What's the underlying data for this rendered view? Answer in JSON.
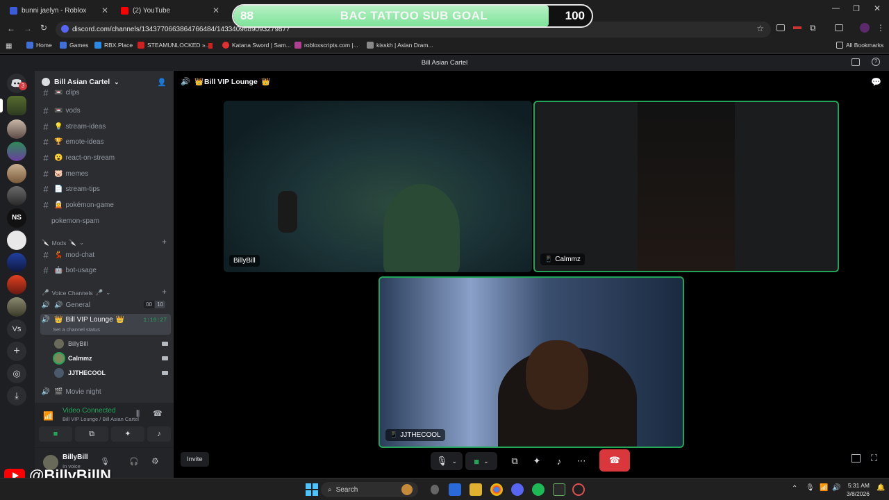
{
  "browser": {
    "tabs": [
      {
        "title": "bunni jaelyn - Roblox",
        "fav_color": "#3b5bdb"
      },
      {
        "title": "(2) YouTube",
        "fav_color": "#ff0000"
      }
    ],
    "url": "discord.com/channels/1343770663864766484/1433409689093279877",
    "bookmarks": [
      {
        "label": "Home",
        "color": "#3f6fd8"
      },
      {
        "label": "Games",
        "color": "#3f6fd8"
      },
      {
        "label": "RBX.Place",
        "color": "#2b8ae6"
      },
      {
        "label": "STEAMUNLOCKED »...",
        "color": "#d02020"
      },
      {
        "label": "Katana Sword | Sam...",
        "color": "#e03030"
      },
      {
        "label": "robloxscripts.com |...",
        "color": "#b04090"
      },
      {
        "label": "kisskh | Asian Dram...",
        "color": "#888888"
      }
    ],
    "all_bookmarks": "All Bookmarks"
  },
  "subgoal": {
    "current": "88",
    "title": "BAC TATTOO SUB GOAL",
    "target": "100",
    "progress": 0.88
  },
  "discord": {
    "window_title": "Bill Asian Cartel",
    "guild_name": "Bill Asian Cartel",
    "text_channels": [
      {
        "name": "clips",
        "emoji": "📼"
      },
      {
        "name": "vods",
        "emoji": "📼"
      },
      {
        "name": "stream-ideas",
        "emoji": "💡"
      },
      {
        "name": "emote-ideas",
        "emoji": "🏆"
      },
      {
        "name": "react-on-stream",
        "emoji": "😮"
      },
      {
        "name": "memes",
        "emoji": "🐷"
      },
      {
        "name": "stream-tips",
        "emoji": "📄"
      },
      {
        "name": "pokémon-game",
        "emoji": "🧝"
      },
      {
        "name": "pokemon-spam",
        "emoji": ""
      }
    ],
    "mods_category": "Mods",
    "mod_channels": [
      {
        "name": "mod-chat",
        "emoji": "💃"
      },
      {
        "name": "bot-usage",
        "emoji": "🤖"
      }
    ],
    "voice_category": "Voice Channels",
    "voice_channels": {
      "general": {
        "name": "General",
        "count_a": "00",
        "count_b": "10"
      },
      "vip": {
        "name": "Bill VIP Lounge",
        "timer": "1:10:27",
        "status": "Set a channel status"
      },
      "movie": {
        "name": "Movie night"
      }
    },
    "members": [
      "BillyBill",
      "Calmmz",
      "JJTHECOOL"
    ],
    "voice_panel": {
      "status": "Video Connected",
      "location": "Bill VIP Lounge / Bill Asian Cartel"
    },
    "user": {
      "name": "BillyBill",
      "state": "In voice"
    },
    "call_header": "Bill VIP Lounge",
    "tiles": [
      {
        "name": "BillyBill"
      },
      {
        "name": "Calmmz"
      },
      {
        "name": "JJTHECOOL"
      }
    ],
    "invite_label": "Invite",
    "rail_badge": "3",
    "rail_labels": {
      "ns": "NS",
      "vs": "Vs"
    }
  },
  "taskbar": {
    "search_label": "Search",
    "time": "5:31 AM",
    "date": "3/8/2026"
  },
  "overlay_handle": "@BillyBillN",
  "colors": {
    "accent_green": "#23a559",
    "hangup_red": "#da373c",
    "blurple": "#5865f2"
  }
}
